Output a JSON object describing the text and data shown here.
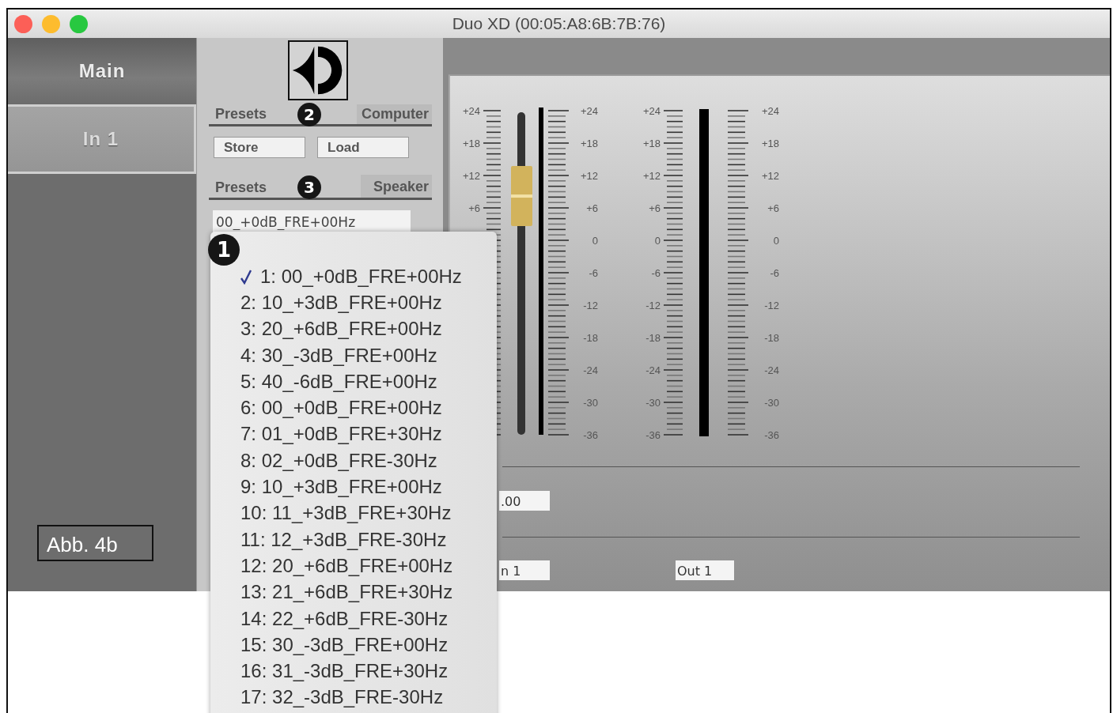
{
  "window": {
    "title": "Duo XD (00:05:A8:6B:7B:76)"
  },
  "tabs": [
    {
      "label": "Main",
      "selected": false
    },
    {
      "label": "In 1",
      "selected": true
    }
  ],
  "presets_computer": {
    "title": "Presets",
    "source": "Computer",
    "buttons": [
      "Store",
      "Load"
    ]
  },
  "presets_speaker": {
    "title": "Presets",
    "source": "Speaker",
    "value": "00_+0dB_FRE+00Hz"
  },
  "fader": {
    "level": 0.74
  },
  "meters": [
    {
      "left_labels": [
        "+24",
        "+18",
        "+12",
        "+6"
      ],
      "right_labels": [
        "+24",
        "+18",
        "+12",
        "+6",
        "0",
        "-6",
        "-12",
        "-18",
        "-24",
        "-30",
        "-36"
      ]
    },
    {
      "left_labels": [
        "+24",
        "+18",
        "+12",
        "+6",
        "0",
        "-6",
        "-12",
        "-18",
        "-24",
        "-30",
        "-36"
      ],
      "right_labels": [
        "+24",
        "+18",
        "+12",
        "+6",
        "0",
        "-6",
        "-12",
        "-18",
        "-24",
        "-30",
        "-36"
      ]
    }
  ],
  "gain_field": {
    "value": ".00"
  },
  "routing_fields": [
    "n 1",
    "Out 1"
  ],
  "preset_menu": {
    "items": [
      {
        "label": "1: 00_+0dB_FRE+00Hz",
        "selected": true
      },
      {
        "label": "2: 10_+3dB_FRE+00Hz",
        "selected": false
      },
      {
        "label": "3: 20_+6dB_FRE+00Hz",
        "selected": false
      },
      {
        "label": "4: 30_-3dB_FRE+00Hz",
        "selected": false
      },
      {
        "label": "5: 40_-6dB_FRE+00Hz",
        "selected": false
      },
      {
        "label": "6: 00_+0dB_FRE+00Hz",
        "selected": false
      },
      {
        "label": "7: 01_+0dB_FRE+30Hz",
        "selected": false
      },
      {
        "label": "8: 02_+0dB_FRE-30Hz",
        "selected": false
      },
      {
        "label": "9: 10_+3dB_FRE+00Hz",
        "selected": false
      },
      {
        "label": "10: 11_+3dB_FRE+30Hz",
        "selected": false
      },
      {
        "label": "11: 12_+3dB_FRE-30Hz",
        "selected": false
      },
      {
        "label": "12: 20_+6dB_FRE+00Hz",
        "selected": false
      },
      {
        "label": "13: 21_+6dB_FRE+30Hz",
        "selected": false
      },
      {
        "label": "14: 22_+6dB_FRE-30Hz",
        "selected": false
      },
      {
        "label": "15: 30_-3dB_FRE+00Hz",
        "selected": false
      },
      {
        "label": "16: 31_-3dB_FRE+30Hz",
        "selected": false
      },
      {
        "label": "17: 32_-3dB_FRE-30Hz",
        "selected": false
      }
    ]
  },
  "callouts": [
    {
      "label": "2"
    },
    {
      "label": "3"
    },
    {
      "label": "1"
    }
  ],
  "figure_label": "Abb. 4b"
}
